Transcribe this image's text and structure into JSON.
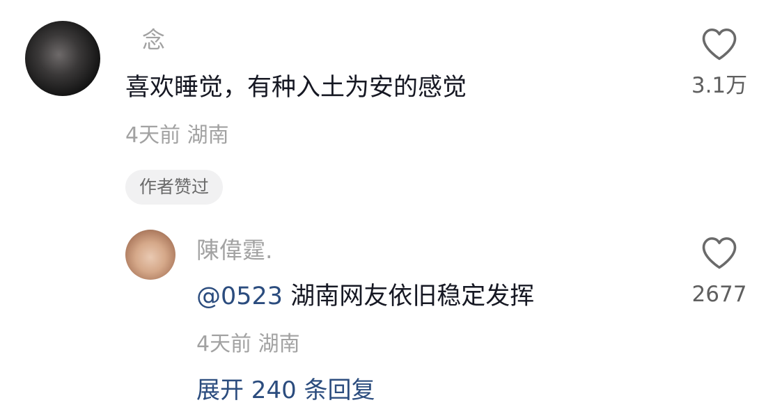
{
  "comment": {
    "username": "念",
    "text": "喜欢睡觉，有种入土为安的感觉",
    "meta": "4天前 湖南",
    "badge": "作者赞过",
    "likes": "3.1万"
  },
  "reply": {
    "username": "陳偉霆.",
    "mention": "@0523",
    "text": " 湖南网友依旧稳定发挥",
    "meta": "4天前 湖南",
    "likes": "2677"
  },
  "expand_replies": "展开 240 条回复",
  "colors": {
    "username": "#a2a2a2",
    "text": "#161823",
    "mention": "#2b4c7e",
    "badge_bg": "#f1f1f2"
  },
  "icons": {
    "like": "heart-outline-icon"
  }
}
